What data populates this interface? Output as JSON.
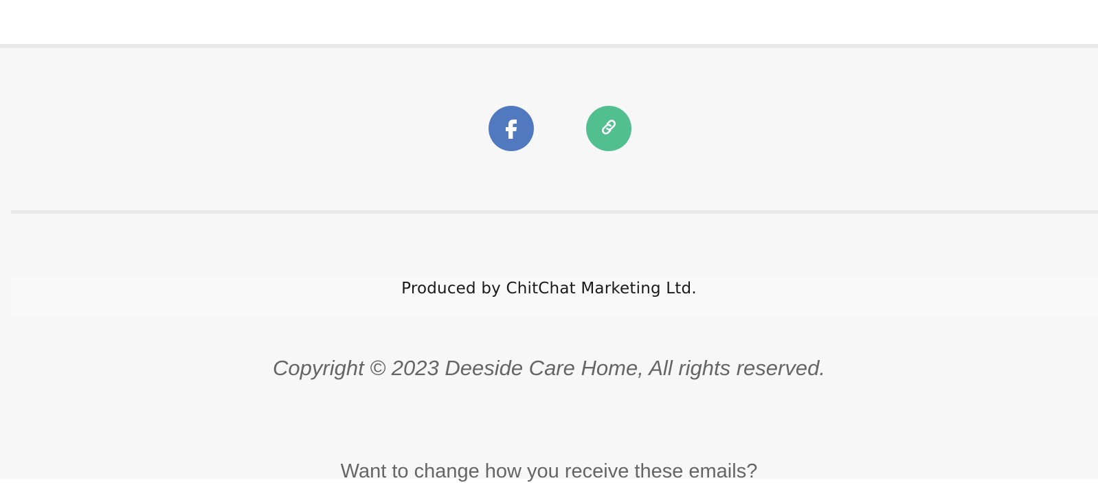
{
  "social": {
    "facebook": {
      "icon": "facebook-icon",
      "color": "#5079c0"
    },
    "website": {
      "icon": "link-icon",
      "color": "#51bf90"
    }
  },
  "footer": {
    "produced_by": "Produced by ChitChat Marketing Ltd.",
    "copyright": "Copyright © 2023 Deeside Care Home, All rights reserved.",
    "change_prefs": "Want to change how you receive these emails?"
  }
}
